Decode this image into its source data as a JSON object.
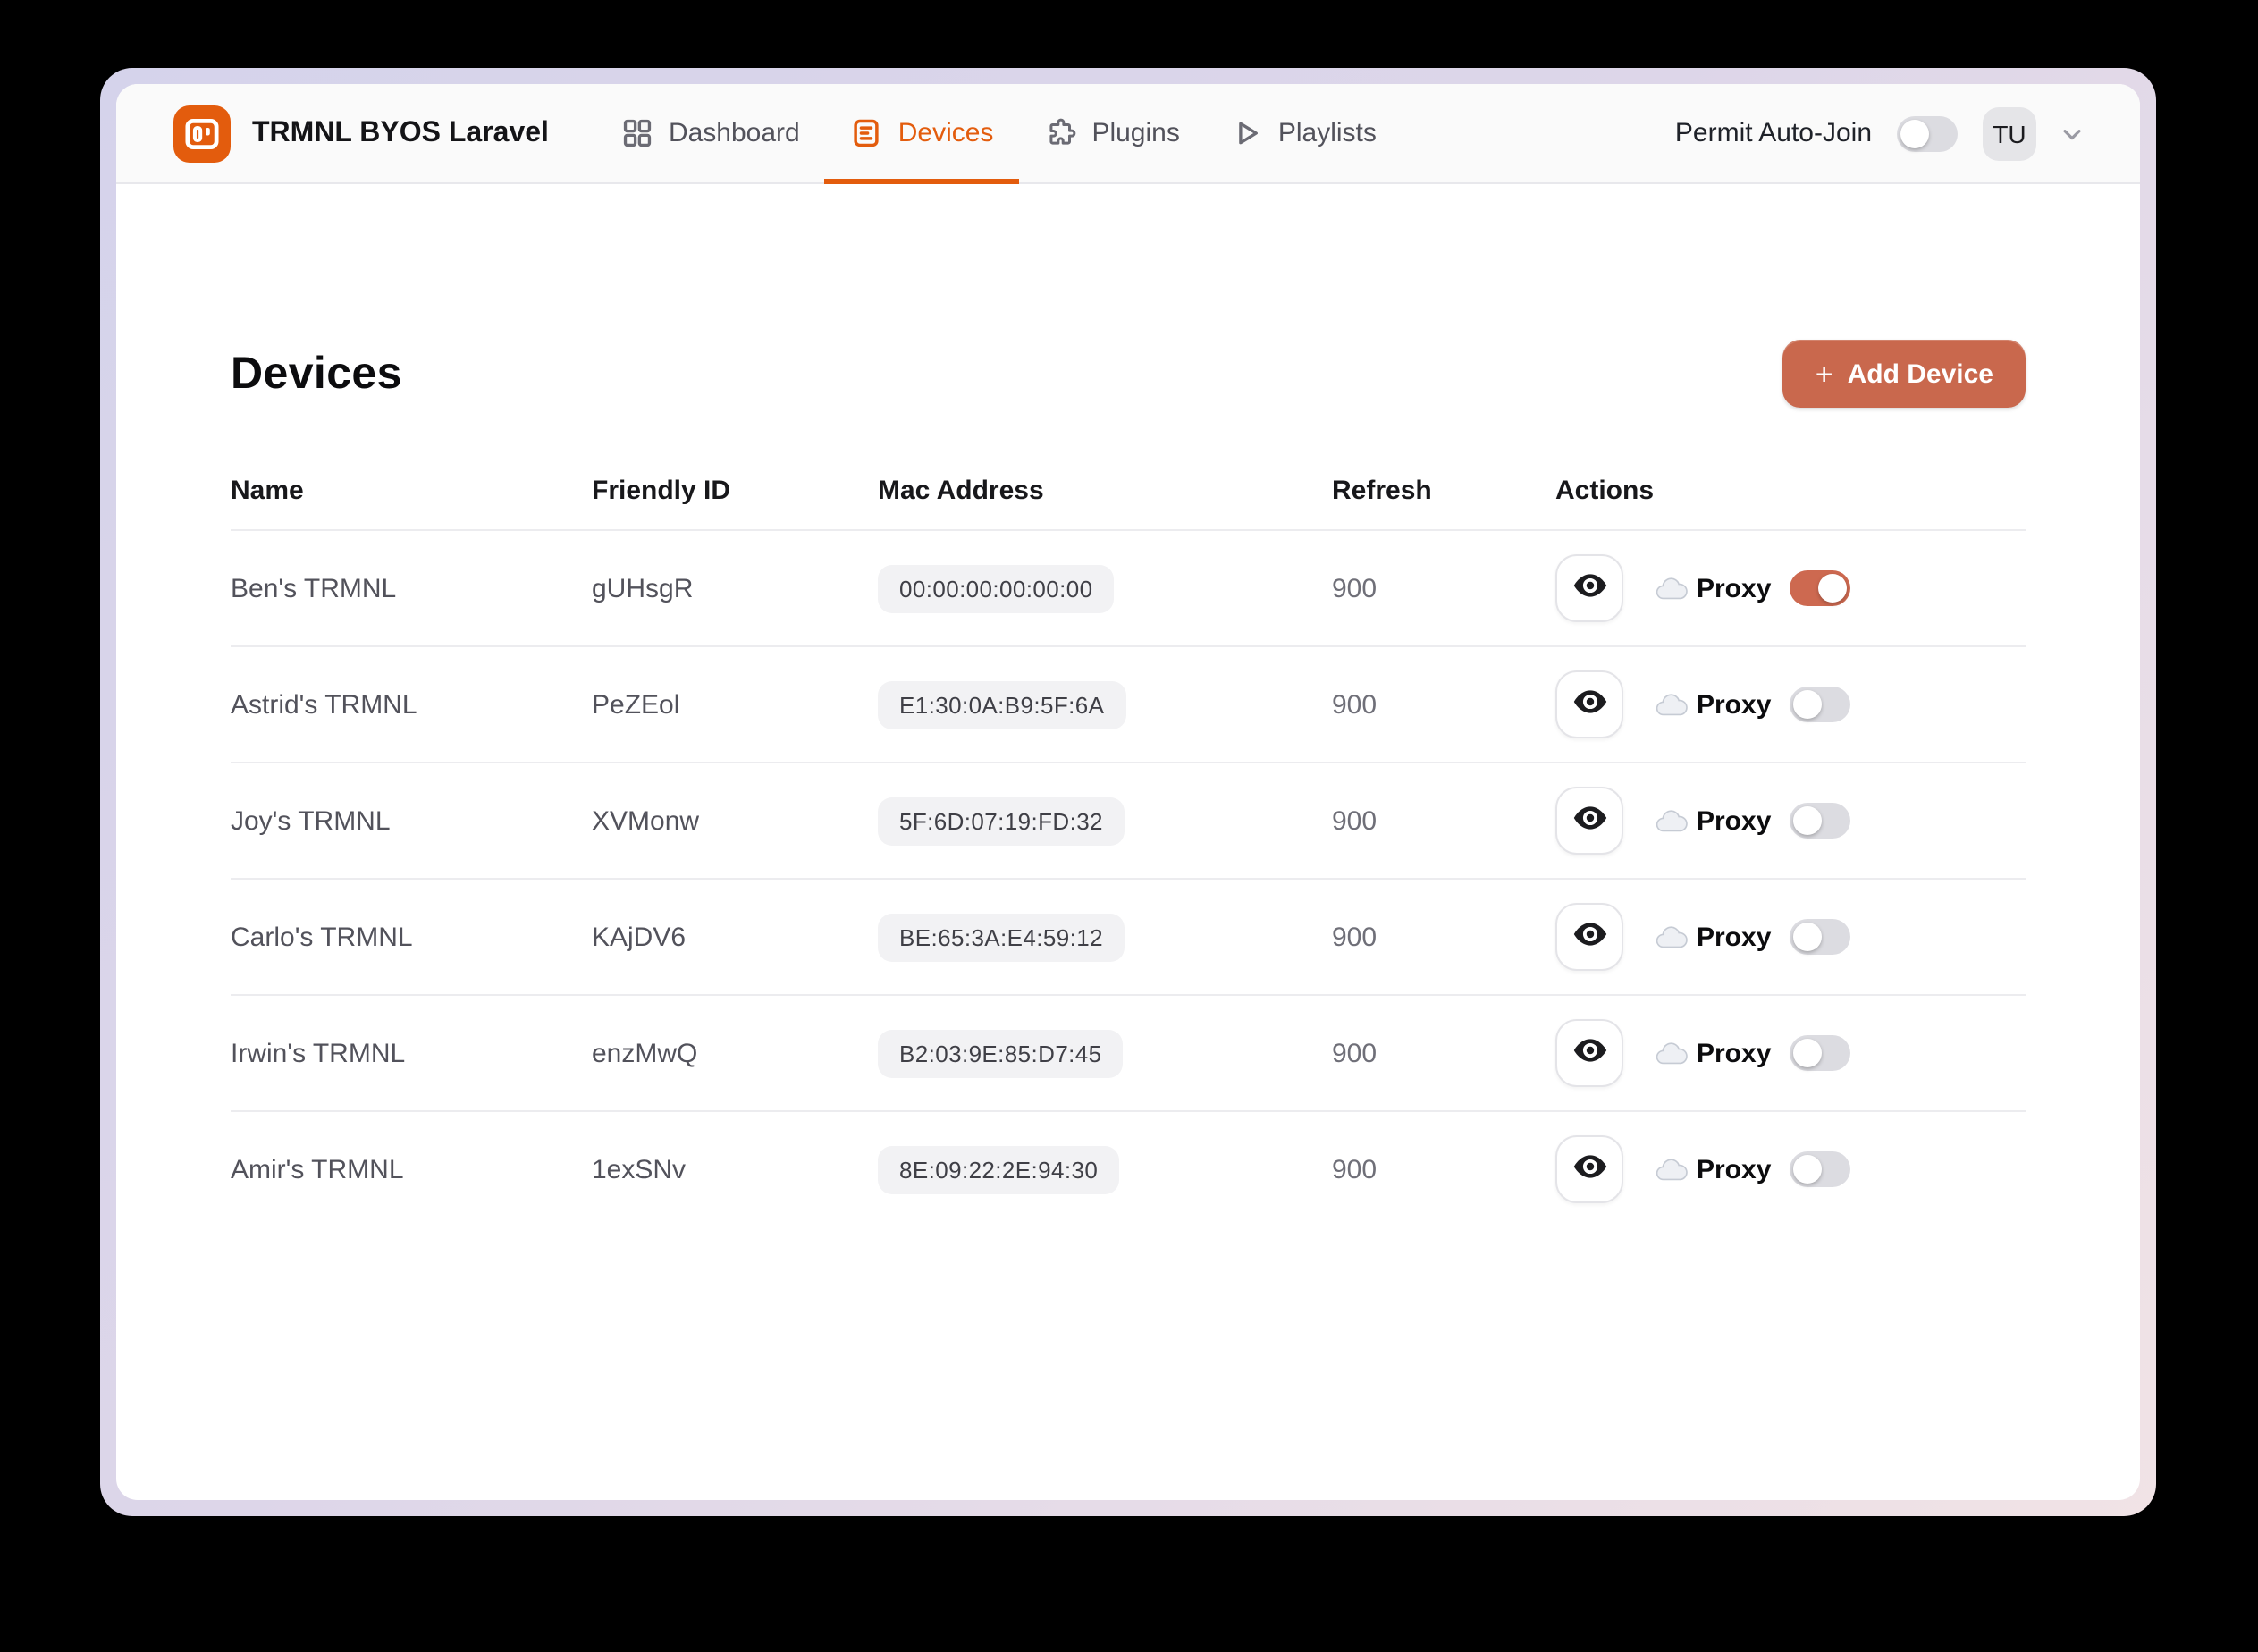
{
  "app": {
    "title": "TRMNL BYOS Laravel"
  },
  "nav": {
    "items": [
      {
        "label": "Dashboard",
        "icon": "dashboard-grid-icon",
        "active": false
      },
      {
        "label": "Devices",
        "icon": "devices-list-icon",
        "active": true
      },
      {
        "label": "Plugins",
        "icon": "plugins-puzzle-icon",
        "active": false
      },
      {
        "label": "Playlists",
        "icon": "playlists-play-icon",
        "active": false
      }
    ]
  },
  "header_right": {
    "auto_join_label": "Permit Auto-Join",
    "auto_join_enabled": false,
    "avatar_initials": "TU"
  },
  "page": {
    "title": "Devices",
    "add_button_plus": "+",
    "add_button_label": "Add Device"
  },
  "table": {
    "columns": [
      "Name",
      "Friendly ID",
      "Mac Address",
      "Refresh",
      "Actions"
    ],
    "proxy_label": "Proxy",
    "rows": [
      {
        "name": "Ben's TRMNL",
        "friendly_id": "gUHsgR",
        "mac": "00:00:00:00:00:00",
        "refresh": "900",
        "proxy_enabled": true
      },
      {
        "name": "Astrid's TRMNL",
        "friendly_id": "PeZEol",
        "mac": "E1:30:0A:B9:5F:6A",
        "refresh": "900",
        "proxy_enabled": false
      },
      {
        "name": "Joy's TRMNL",
        "friendly_id": "XVMonw",
        "mac": "5F:6D:07:19:FD:32",
        "refresh": "900",
        "proxy_enabled": false
      },
      {
        "name": "Carlo's TRMNL",
        "friendly_id": "KAjDV6",
        "mac": "BE:65:3A:E4:59:12",
        "refresh": "900",
        "proxy_enabled": false
      },
      {
        "name": "Irwin's TRMNL",
        "friendly_id": "enzMwQ",
        "mac": "B2:03:9E:85:D7:45",
        "refresh": "900",
        "proxy_enabled": false
      },
      {
        "name": "Amir's TRMNL",
        "friendly_id": "1exSNv",
        "mac": "8E:09:22:2E:94:30",
        "refresh": "900",
        "proxy_enabled": false
      }
    ]
  },
  "colors": {
    "accent_orange": "#e35c0d",
    "accent_terracotta": "#c9684d",
    "toggle_on": "#cd6950",
    "toggle_off": "#dcdce1"
  }
}
